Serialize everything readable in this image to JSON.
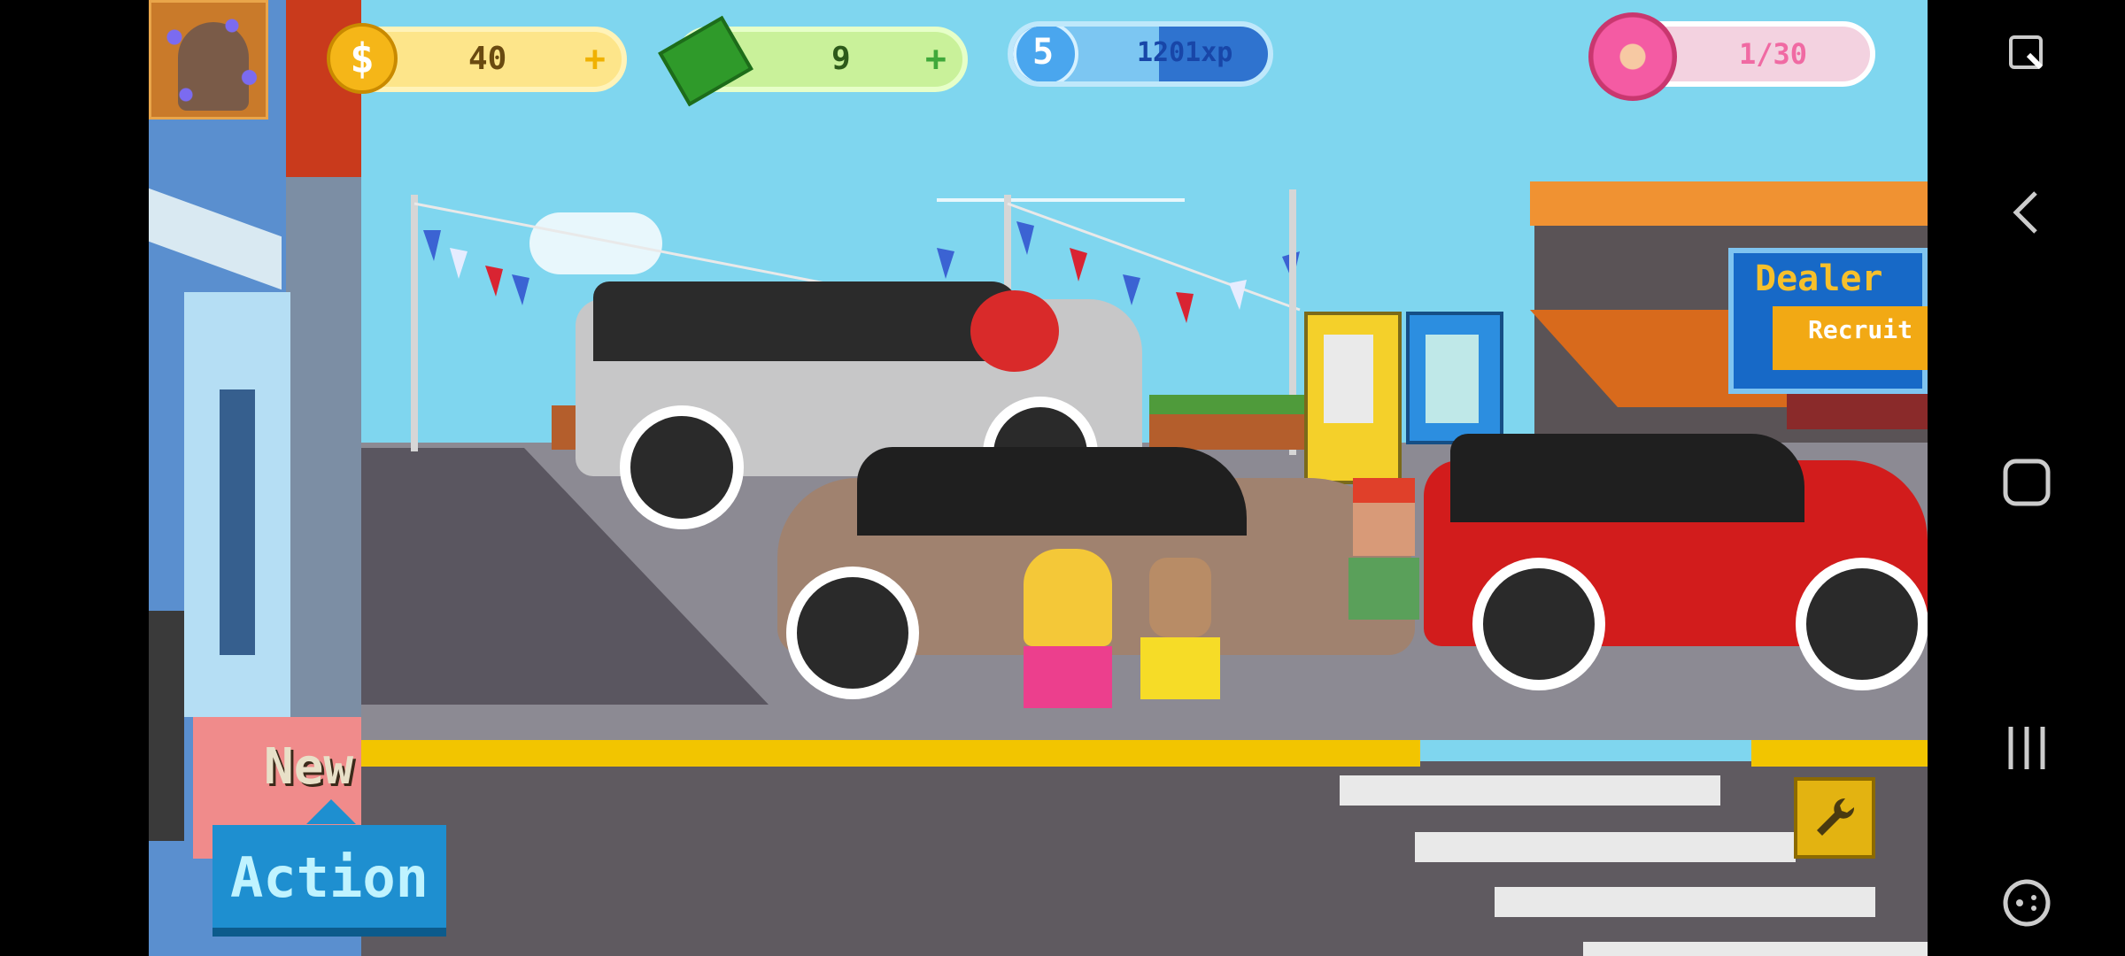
{
  "hud": {
    "coins": "40",
    "cash": "9",
    "level": "5",
    "xp": "1201xp",
    "donuts": "1/30",
    "xp_progress": 0.55
  },
  "buttons": {
    "new_label": "New",
    "action_label": "Action"
  },
  "dealer_sign": {
    "title": "Dealer",
    "recruit_label": "Recruit"
  },
  "colors": {
    "sky": "#7fd6ef",
    "coin_bg": "#fde58a",
    "cash_bg": "#c9f19a",
    "xp_bg": "#7cc6f2",
    "donut_bg": "#f3d2e0",
    "action_blue": "#1e8fd0",
    "road_yellow": "#f2c500"
  },
  "navbar": {
    "icons": [
      "screenshot-edit-icon",
      "back-icon",
      "home-icon",
      "recents-icon",
      "game-controller-icon"
    ]
  }
}
